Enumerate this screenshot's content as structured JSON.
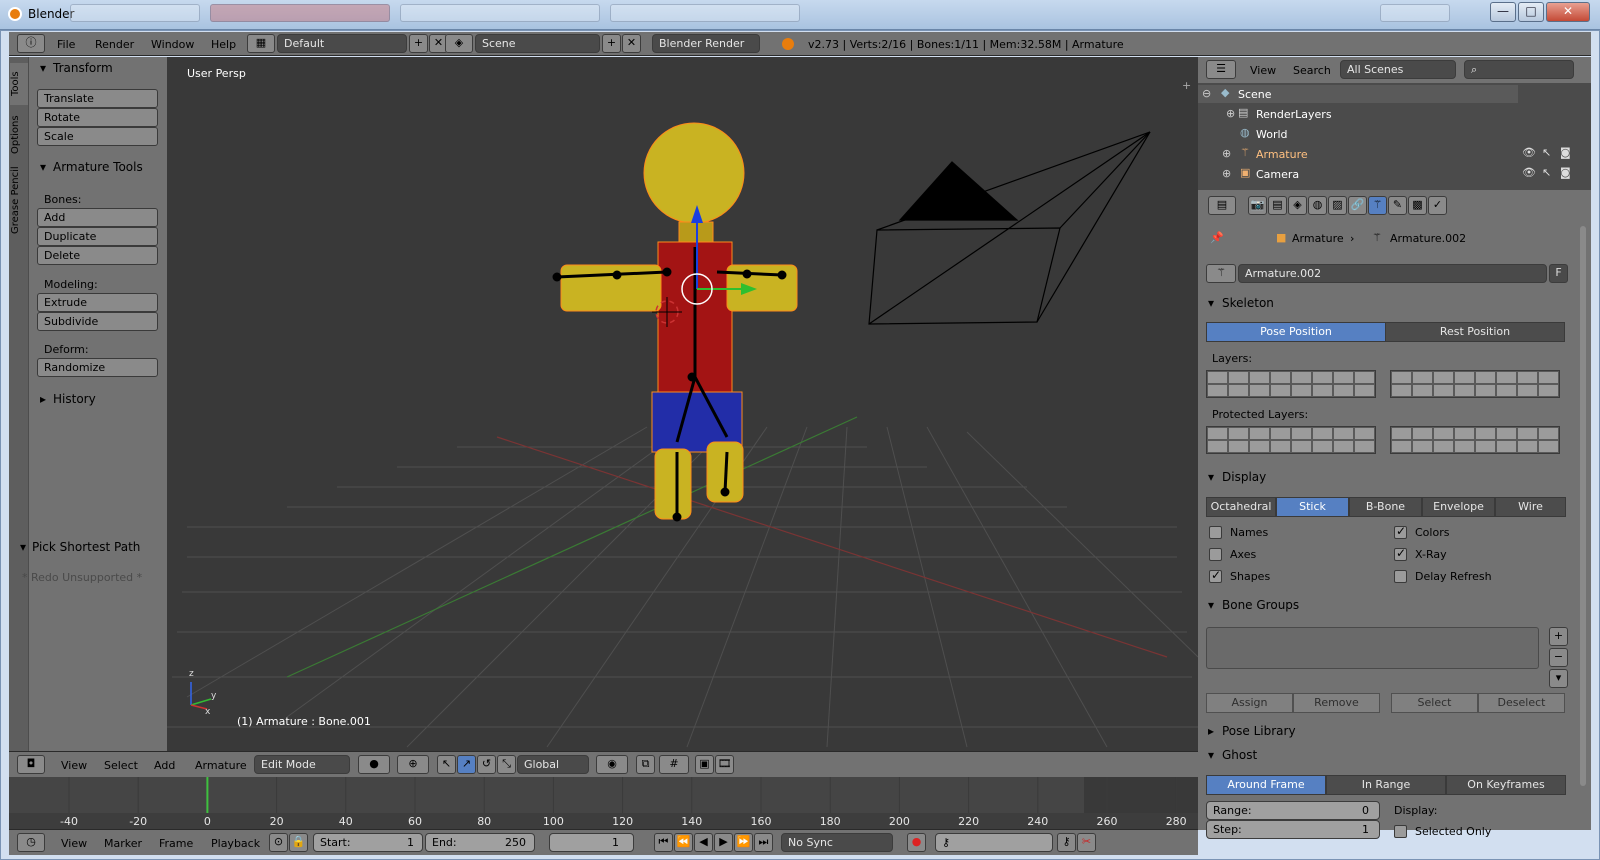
{
  "window": {
    "title": "Blender",
    "btn_min": "—",
    "btn_max": "□",
    "btn_close": "✕"
  },
  "info": {
    "menus": [
      "File",
      "Render",
      "Window",
      "Help"
    ],
    "layout": "Default",
    "scene": "Scene",
    "engine": "Blender Render",
    "stats": "v2.73 | Verts:2/16 | Bones:1/11 | Mem:32.58M | Armature"
  },
  "tool_shelf": {
    "tabs": [
      "Tools",
      "Options",
      "Grease Pencil"
    ],
    "transform": {
      "title": "Transform",
      "buttons": [
        "Translate",
        "Rotate",
        "Scale"
      ]
    },
    "armature_tools": {
      "title": "Armature Tools",
      "bones_label": "Bones:",
      "bones": [
        "Add",
        "Duplicate",
        "Delete"
      ],
      "modeling_label": "Modeling:",
      "modeling": [
        "Extrude",
        "Subdivide"
      ],
      "deform_label": "Deform:",
      "deform": [
        "Randomize"
      ]
    },
    "history": "History",
    "operator": {
      "title": "Pick Shortest Path",
      "note": "* Redo Unsupported *"
    }
  },
  "viewport": {
    "label": "User Persp",
    "status": "(1) Armature : Bone.001",
    "axis_x": "x",
    "axis_y": "y",
    "axis_z": "z"
  },
  "viewport_header": {
    "menus": [
      "View",
      "Select",
      "Add",
      "Armature"
    ],
    "mode": "Edit Mode",
    "orientation": "Global"
  },
  "timeline": {
    "ticks": [
      "-40",
      "-20",
      "0",
      "20",
      "40",
      "60",
      "80",
      "100",
      "120",
      "140",
      "160",
      "180",
      "200",
      "220",
      "240",
      "260",
      "280"
    ],
    "current_frame": 0
  },
  "timeline_header": {
    "menus": [
      "View",
      "Marker",
      "Frame",
      "Playback"
    ],
    "start_label": "Start:",
    "start": "1",
    "end_label": "End:",
    "end": "250",
    "current": "1",
    "sync": "No Sync"
  },
  "outliner": {
    "menus": [
      "View",
      "Search"
    ],
    "filter": "All Scenes",
    "rows": [
      {
        "name": "Scene",
        "indent": 0
      },
      {
        "name": "RenderLayers",
        "indent": 1
      },
      {
        "name": "World",
        "indent": 1
      },
      {
        "name": "Armature",
        "indent": 1
      },
      {
        "name": "Camera",
        "indent": 1
      }
    ]
  },
  "properties": {
    "breadcrumb": [
      "Armature",
      "Armature.002"
    ],
    "datablock": "Armature.002",
    "fake_user": "F",
    "skeleton": {
      "title": "Skeleton",
      "pose_position": "Pose Position",
      "rest_position": "Rest Position",
      "active": "Pose Position",
      "layers_label": "Layers:",
      "protected_label": "Protected Layers:"
    },
    "display": {
      "title": "Display",
      "modes": [
        "Octahedral",
        "Stick",
        "B-Bone",
        "Envelope",
        "Wire"
      ],
      "active": "Stick",
      "options": [
        {
          "label": "Names",
          "checked": false
        },
        {
          "label": "Colors",
          "checked": true
        },
        {
          "label": "Axes",
          "checked": false
        },
        {
          "label": "X-Ray",
          "checked": true
        },
        {
          "label": "Shapes",
          "checked": true
        },
        {
          "label": "Delay Refresh",
          "checked": false
        }
      ]
    },
    "bone_groups": {
      "title": "Bone Groups",
      "buttons": [
        "Assign",
        "Remove",
        "Select",
        "Deselect"
      ]
    },
    "pose_library": "Pose Library",
    "ghost": {
      "title": "Ghost",
      "modes": [
        "Around Frame",
        "In Range",
        "On Keyframes"
      ],
      "active": "Around Frame",
      "range_label": "Range:",
      "range": "0",
      "step_label": "Step:",
      "step": "1",
      "display_label": "Display:",
      "selected_only": "Selected Only"
    }
  },
  "colors": {
    "accent": "#5680c2",
    "viewport_bg": "#393939",
    "panel_bg": "#727272"
  }
}
